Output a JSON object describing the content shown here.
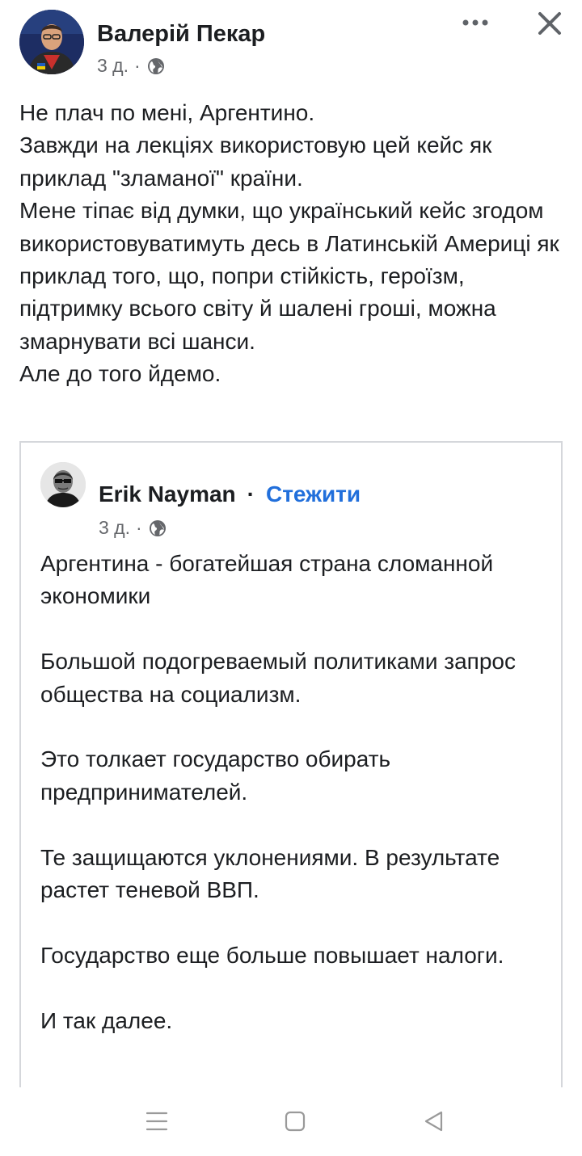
{
  "post": {
    "author": "Валерій Пекар",
    "time": "3 д.",
    "separator": "·",
    "audience_icon": "globe-icon",
    "lines": [
      "Не плач по мені, Аргентино.",
      "Завжди на лекціях використовую цей кейс як приклад \"зламаної\" країни.",
      "Мене тіпає від думки, що український кейс згодом використовуватимуть десь в Латинській Америці як приклад того, що, попри стійкість, героїзм, підтримку всього світу й шалені гроші, можна змарнувати всі шанси.",
      "Але до того йдемо."
    ]
  },
  "shared": {
    "author": "Erik Nayman",
    "separator": "·",
    "follow_label": "Стежити",
    "time": "3 д.",
    "meta_separator": "·",
    "audience_icon": "globe-icon",
    "paragraphs": [
      "Аргентина - богатейшая страна сломанной экономики",
      "Большой подогреваемый политиками запрос общества на социализм.",
      "Это толкает государство обирать предпринимателей.",
      "Те защищаются уклонениями. В результате растет теневой ВВП.",
      "Государство еще больше повышает налоги.",
      "И так далее."
    ]
  },
  "header_icons": {
    "more": "more-options-icon",
    "close": "close-icon"
  },
  "navbar": {
    "menu": "menu-icon",
    "home": "home-square-icon",
    "back": "back-triangle-icon"
  },
  "colors": {
    "link": "#216fdb",
    "text": "#1c1e21",
    "meta": "#65676b",
    "border": "#d5d7db"
  }
}
